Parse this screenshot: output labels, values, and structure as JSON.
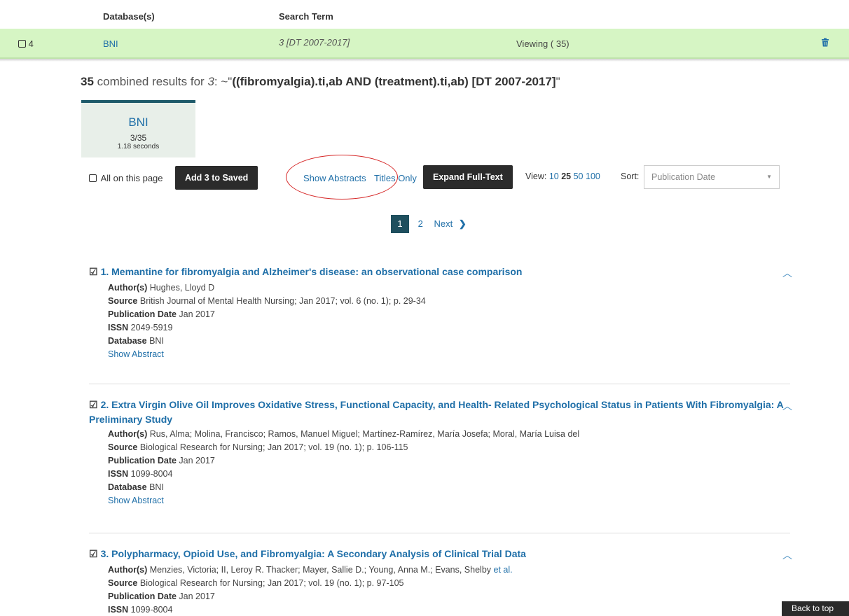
{
  "history": {
    "headers": {
      "databases": "Database(s)",
      "search_term": "Search Term"
    },
    "row": {
      "number": "4",
      "database": "BNI",
      "term": "3 [DT 2007-2017]",
      "status": "Viewing ( 35)"
    },
    "row_color": "#d6f5c4"
  },
  "summary": {
    "count": "35",
    "text": " combined results for ",
    "set_ref": "3",
    "colon": ": ~\"",
    "query": "((fibromyalgia).ti,ab AND (treatment).ti,ab) [DT 2007-2017]",
    "close_quote": "\""
  },
  "db_tile": {
    "name": "BNI",
    "count": "3/35",
    "time": "1.18 seconds"
  },
  "toolbar": {
    "select_all_label": "All on this page",
    "add_saved_label": "Add 3 to Saved",
    "show_abstracts": "Show Abstracts",
    "titles_only": "Titles Only",
    "expand_full_text": "Expand Full-Text",
    "view_label": "View:",
    "view_options": [
      "10",
      "25",
      "50",
      "100"
    ],
    "sort_label": "Sort:",
    "sort_value": "Publication Date"
  },
  "pager": {
    "current": "1",
    "next_page": "2",
    "next_label": "Next"
  },
  "results": [
    {
      "title": "1. Memantine for fibromyalgia and Alzheimer's disease: an observational case comparison",
      "authors": "Hughes, Lloyd D",
      "source": "British Journal of Mental Health Nursing; Jan 2017; vol. 6 (no. 1); p. 29-34",
      "pub_date": "Jan 2017",
      "issn": "2049-5919",
      "database": "BNI",
      "show_abstract": "Show Abstract"
    },
    {
      "title": "2. Extra Virgin Olive Oil Improves Oxidative Stress, Functional Capacity, and Health- Related Psychological Status in Patients With Fibromyalgia: A Preliminary Study",
      "authors": "Rus, Alma; Molina, Francisco; Ramos, Manuel Miguel; Martínez-Ramírez, María Josefa; Moral, María Luisa del",
      "source": "Biological Research for Nursing; Jan 2017; vol. 19 (no. 1); p. 106-115",
      "pub_date": "Jan 2017",
      "issn": "1099-8004",
      "database": "BNI",
      "show_abstract": "Show Abstract"
    },
    {
      "title": "3. Polypharmacy, Opioid Use, and Fibromyalgia: A Secondary Analysis of Clinical Trial Data",
      "authors": "Menzies, Victoria; II, Leroy R. Thacker; Mayer, Sallie D.; Young, Anna M.; Evans, Shelby",
      "authors_more": "et al.",
      "source": "Biological Research for Nursing; Jan 2017; vol. 19 (no. 1); p. 97-105",
      "pub_date": "Jan 2017",
      "issn": "1099-8004"
    }
  ],
  "labels": {
    "authors": "Author(s)",
    "source": "Source",
    "pub_date": "Publication Date",
    "issn": "ISSN",
    "database": "Database"
  },
  "back_to_top": "Back to top"
}
